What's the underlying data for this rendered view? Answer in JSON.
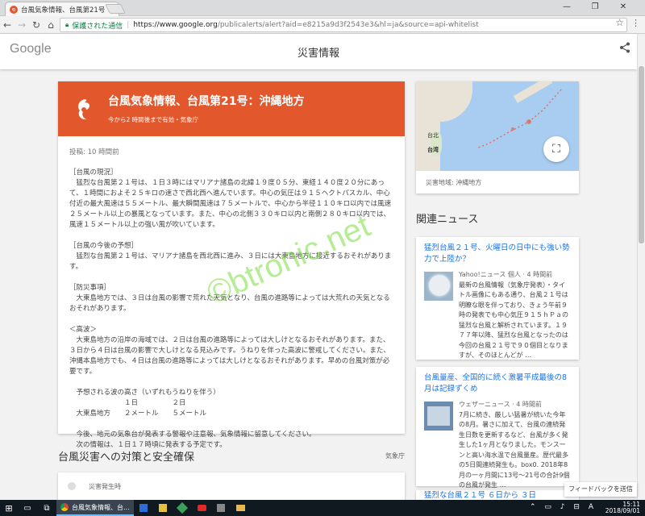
{
  "browser": {
    "tab_title": "台風気象情報、台風第21号",
    "tab_close": "×",
    "win_min": "—",
    "win_max": "❐",
    "win_close": "✕",
    "back": "←",
    "forward": "→",
    "reload": "↻",
    "home": "⌂",
    "secure_label": "保護された通信",
    "url_host": "https://www.google.org",
    "url_path": "/publicalerts/alert?aid=e8215a9d3f2543e3&hl=ja&source=api-whitelist",
    "star": "☆",
    "menu": "⋮"
  },
  "appbar": {
    "logo": "Google",
    "title": "災害情報",
    "share": "⋖"
  },
  "alert": {
    "icon": "໑",
    "title": "台風気象情報、台風第21号：沖縄地方",
    "subtitle": "今から2 時間後まで有効・気象庁",
    "posted": "投稿: 10 時間前",
    "body": "［台風の現況］\n　猛烈な台風第２１号は、１日３時にはマリアナ諸島の北緯１９度０５分、東経１４０度２０分にあって、１時間におよそ２５キロの速さで西北西へ進んでいます。中心の気圧は９１５ヘクトパスカル、中心付近の最大風速は５５メートル、最大瞬間風速は７５メートルで、中心から半径１１０キロ以内では風速２５メートル以上の暴風となっています。また、中心の北側３３０キロ以内と南側２８０キロ以内では、風速１５メートル以上の強い風が吹いています。\n\n［台風の今後の予想］\n　猛烈な台風第２１号は、マリアナ諸島を西北西に進み、３日には大東島地方に接近するおそれがあります。\n\n［防災事項］\n　大東島地方では、３日は台風の影響で荒れた天気となり、台風の進路等によっては大荒れの天気となるおそれがあります。\n\n＜高波＞\n　大東島地方の沿岸の海域では、２日は台風の進路等によっては大しけとなるおそれがあります。また、３日から４日は台風の影響で大しけとなる見込みです。うねりを伴った高波に警戒してください。また、沖縄本島地方でも、４日は台風の進路等によっては大しけとなるおそれがあります。早めの台風対策が必要です。\n\n　予想される波の高さ（いずれもうねりを伴う）\n　　　　　　　　１日　　　　　２日\n　大東島地方　　２メートル　　５メートル\n\n　今後、地元の気象台が発表する警報や注意報、気象情報に留意してください。\n　次の情報は、１日１７時頃に発表する予定です。"
  },
  "map": {
    "label_taipei": "台北",
    "label_taiwan": "台湾",
    "fullscreen": "⛶",
    "area": "災害地域: 沖縄地方"
  },
  "related": {
    "heading": "関連ニュース",
    "items": [
      {
        "title": "猛烈台風２１号、火曜日の日中にも強い勢力で上陸か？",
        "source": "Yahoo!ニュース 個人 · 4 時間前",
        "snippet": "最新の台風情報（気象庁発表）・タイトル画像にもある通り、台風２１号は明瞭な眼を伴っており、きょう午前９時の発表でも中心気圧９１５ｈＰａの猛烈な台風と解析されています。１９７７年以降、猛烈な台風となったのは今回の台風２１号で９０個目となりますが、そのほとんどが …"
      },
      {
        "title": "台風量産、全国的に続く激暑平成最後の8月は記録ずくめ",
        "source": "ウェザーニュース · 4 時間前",
        "snippet": "7月に続き、厳しい猛暑が続いた今年の8月。暑さに加えて、台風の連続発生日数を更新するなど、台風が多く発生した1ヶ月となりました。モンスーンと高い海水温で台風量産。歴代最多の5日間連続発生も。box0. 2018年8月の一ヶ月間に13号〜21号の合計9個の台風が発生 …"
      },
      {
        "title": "猛烈な台風２１号 ６日から ３日"
      }
    ]
  },
  "section": {
    "heading": "台風災害への対策と安全確保",
    "source": "気象庁",
    "item_label": "災害発生時"
  },
  "feedback": "フィードバックを送信",
  "watermark": "©btronic.net",
  "taskbar": {
    "start": "⊞",
    "active_title": "台風気象情報、台...",
    "ime": "A",
    "time": "15:11",
    "date": "2018/09/01",
    "tray_icons": "⌃ ▭ ♪ ⊟"
  }
}
